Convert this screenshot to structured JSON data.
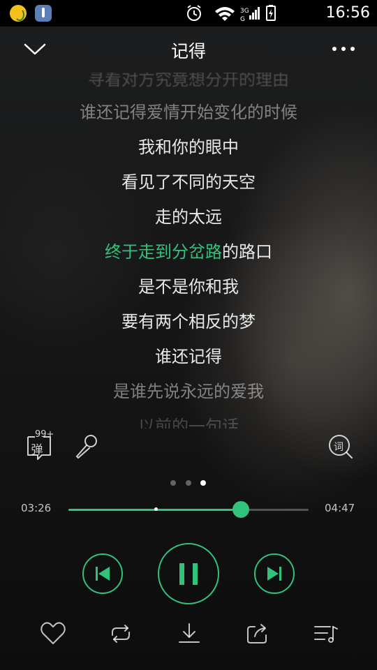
{
  "status_bar": {
    "network_label": "3G",
    "time": "16:56"
  },
  "header": {
    "title": "记得"
  },
  "lyrics": {
    "lines": [
      "谁还记得爱情开始变化的时候",
      "我和你的眼中",
      "看见了不同的天空",
      "走的太远",
      "终于走到分岔路的路口",
      "是不是你和我",
      "要有两个相反的梦",
      "谁还记得",
      "是谁先说永远的爱我",
      "以前的一句话"
    ],
    "active_index": 4,
    "active_sung_part": "终于走到分岔路",
    "active_unsung_part": "的路口",
    "active_color": "#31c27c"
  },
  "tools": {
    "danmu_count": "99+",
    "danmu_char": "弹",
    "lyric_char": "词"
  },
  "pager": {
    "total": 3,
    "current": 3
  },
  "progress": {
    "current_time": "03:26",
    "total_time": "04:47",
    "fraction": 0.718,
    "buffer_fraction": 0.362,
    "accent": "#31c27c"
  },
  "controls": {
    "prev": "skip-previous-icon",
    "play_pause": "pause-icon",
    "next": "skip-next-icon"
  },
  "bottom_bar": {
    "items": [
      "heart-icon",
      "repeat-icon",
      "download-icon",
      "share-icon",
      "playlist-icon"
    ]
  }
}
